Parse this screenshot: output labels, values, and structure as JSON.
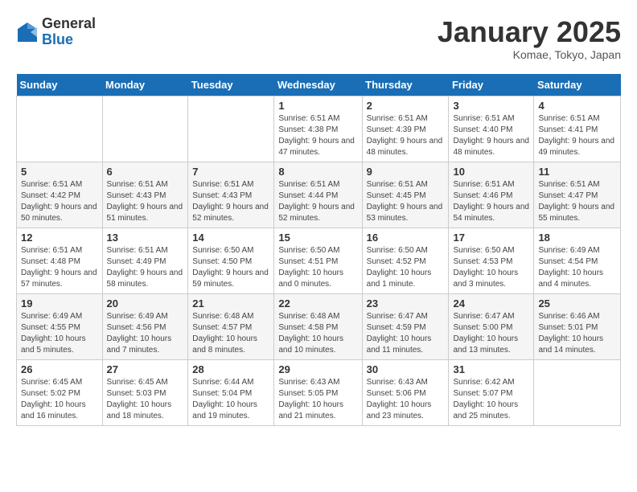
{
  "logo": {
    "general": "General",
    "blue": "Blue"
  },
  "title": "January 2025",
  "subtitle": "Komae, Tokyo, Japan",
  "days_of_week": [
    "Sunday",
    "Monday",
    "Tuesday",
    "Wednesday",
    "Thursday",
    "Friday",
    "Saturday"
  ],
  "weeks": [
    [
      {
        "day": "",
        "info": ""
      },
      {
        "day": "",
        "info": ""
      },
      {
        "day": "",
        "info": ""
      },
      {
        "day": "1",
        "info": "Sunrise: 6:51 AM\nSunset: 4:38 PM\nDaylight: 9 hours and 47 minutes."
      },
      {
        "day": "2",
        "info": "Sunrise: 6:51 AM\nSunset: 4:39 PM\nDaylight: 9 hours and 48 minutes."
      },
      {
        "day": "3",
        "info": "Sunrise: 6:51 AM\nSunset: 4:40 PM\nDaylight: 9 hours and 48 minutes."
      },
      {
        "day": "4",
        "info": "Sunrise: 6:51 AM\nSunset: 4:41 PM\nDaylight: 9 hours and 49 minutes."
      }
    ],
    [
      {
        "day": "5",
        "info": "Sunrise: 6:51 AM\nSunset: 4:42 PM\nDaylight: 9 hours and 50 minutes."
      },
      {
        "day": "6",
        "info": "Sunrise: 6:51 AM\nSunset: 4:43 PM\nDaylight: 9 hours and 51 minutes."
      },
      {
        "day": "7",
        "info": "Sunrise: 6:51 AM\nSunset: 4:43 PM\nDaylight: 9 hours and 52 minutes."
      },
      {
        "day": "8",
        "info": "Sunrise: 6:51 AM\nSunset: 4:44 PM\nDaylight: 9 hours and 52 minutes."
      },
      {
        "day": "9",
        "info": "Sunrise: 6:51 AM\nSunset: 4:45 PM\nDaylight: 9 hours and 53 minutes."
      },
      {
        "day": "10",
        "info": "Sunrise: 6:51 AM\nSunset: 4:46 PM\nDaylight: 9 hours and 54 minutes."
      },
      {
        "day": "11",
        "info": "Sunrise: 6:51 AM\nSunset: 4:47 PM\nDaylight: 9 hours and 55 minutes."
      }
    ],
    [
      {
        "day": "12",
        "info": "Sunrise: 6:51 AM\nSunset: 4:48 PM\nDaylight: 9 hours and 57 minutes."
      },
      {
        "day": "13",
        "info": "Sunrise: 6:51 AM\nSunset: 4:49 PM\nDaylight: 9 hours and 58 minutes."
      },
      {
        "day": "14",
        "info": "Sunrise: 6:50 AM\nSunset: 4:50 PM\nDaylight: 9 hours and 59 minutes."
      },
      {
        "day": "15",
        "info": "Sunrise: 6:50 AM\nSunset: 4:51 PM\nDaylight: 10 hours and 0 minutes."
      },
      {
        "day": "16",
        "info": "Sunrise: 6:50 AM\nSunset: 4:52 PM\nDaylight: 10 hours and 1 minute."
      },
      {
        "day": "17",
        "info": "Sunrise: 6:50 AM\nSunset: 4:53 PM\nDaylight: 10 hours and 3 minutes."
      },
      {
        "day": "18",
        "info": "Sunrise: 6:49 AM\nSunset: 4:54 PM\nDaylight: 10 hours and 4 minutes."
      }
    ],
    [
      {
        "day": "19",
        "info": "Sunrise: 6:49 AM\nSunset: 4:55 PM\nDaylight: 10 hours and 5 minutes."
      },
      {
        "day": "20",
        "info": "Sunrise: 6:49 AM\nSunset: 4:56 PM\nDaylight: 10 hours and 7 minutes."
      },
      {
        "day": "21",
        "info": "Sunrise: 6:48 AM\nSunset: 4:57 PM\nDaylight: 10 hours and 8 minutes."
      },
      {
        "day": "22",
        "info": "Sunrise: 6:48 AM\nSunset: 4:58 PM\nDaylight: 10 hours and 10 minutes."
      },
      {
        "day": "23",
        "info": "Sunrise: 6:47 AM\nSunset: 4:59 PM\nDaylight: 10 hours and 11 minutes."
      },
      {
        "day": "24",
        "info": "Sunrise: 6:47 AM\nSunset: 5:00 PM\nDaylight: 10 hours and 13 minutes."
      },
      {
        "day": "25",
        "info": "Sunrise: 6:46 AM\nSunset: 5:01 PM\nDaylight: 10 hours and 14 minutes."
      }
    ],
    [
      {
        "day": "26",
        "info": "Sunrise: 6:45 AM\nSunset: 5:02 PM\nDaylight: 10 hours and 16 minutes."
      },
      {
        "day": "27",
        "info": "Sunrise: 6:45 AM\nSunset: 5:03 PM\nDaylight: 10 hours and 18 minutes."
      },
      {
        "day": "28",
        "info": "Sunrise: 6:44 AM\nSunset: 5:04 PM\nDaylight: 10 hours and 19 minutes."
      },
      {
        "day": "29",
        "info": "Sunrise: 6:43 AM\nSunset: 5:05 PM\nDaylight: 10 hours and 21 minutes."
      },
      {
        "day": "30",
        "info": "Sunrise: 6:43 AM\nSunset: 5:06 PM\nDaylight: 10 hours and 23 minutes."
      },
      {
        "day": "31",
        "info": "Sunrise: 6:42 AM\nSunset: 5:07 PM\nDaylight: 10 hours and 25 minutes."
      },
      {
        "day": "",
        "info": ""
      }
    ]
  ]
}
